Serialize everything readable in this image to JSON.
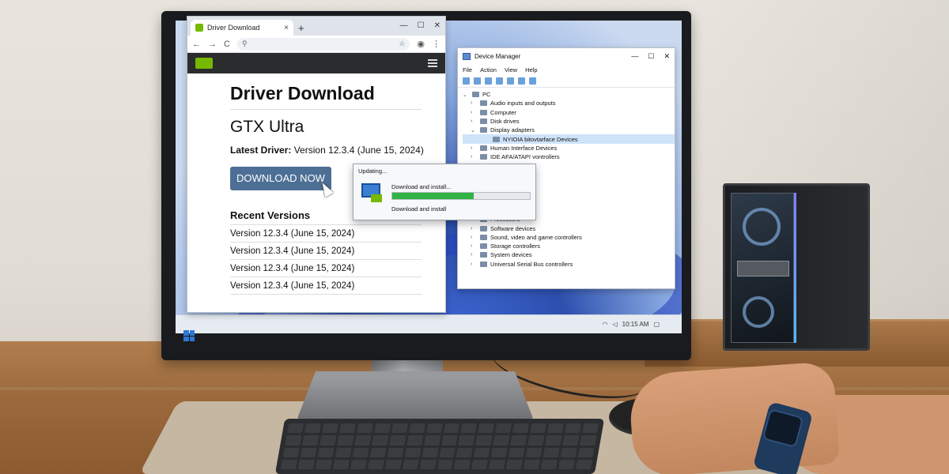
{
  "browser": {
    "tab_title": "Driver Download",
    "tab_close": "×",
    "new_tab": "+",
    "window_controls": [
      "—",
      "☐",
      "✕"
    ],
    "nav": {
      "back": "←",
      "forward": "→",
      "reload": "C"
    },
    "url": "",
    "page": {
      "heading": "Driver Download",
      "product": "GTX Ultra",
      "latest_label": "Latest Driver:",
      "latest_value": "Version 12.3.4 (June 15, 2024)",
      "download_button": "DOWNLOAD NOW",
      "recent_heading": "Recent Versions",
      "versions": [
        "Version 12.3.4 (June 15, 2024)",
        "Version 12.3.4 (June 15, 2024)",
        "Version 12.3.4 (June 15, 2024)",
        "Version 12.3.4 (June 15, 2024)"
      ]
    }
  },
  "device_manager": {
    "title": "Device Manager",
    "window_controls": [
      "—",
      "☐",
      "✕"
    ],
    "menu": [
      "File",
      "Action",
      "View",
      "Help"
    ],
    "root": "PC",
    "items": [
      {
        "label": "Audio inputs and outputs",
        "level": 1,
        "expanded": false
      },
      {
        "label": "Computer",
        "level": 1,
        "expanded": false
      },
      {
        "label": "Disk drives",
        "level": 1,
        "expanded": false
      },
      {
        "label": "Display adapters",
        "level": 1,
        "expanded": true
      },
      {
        "label": "NYIOIA bitovtarface Devices",
        "level": 2,
        "selected": true
      },
      {
        "label": "Human Interface Devices",
        "level": 1,
        "expanded": false
      },
      {
        "label": "IDE AFA/ATAPI vontrollers",
        "level": 1,
        "expanded": false
      },
      {
        "label": "",
        "level": 1,
        "expanded": false
      },
      {
        "label": "ating devices",
        "level": 1,
        "expanded": false
      },
      {
        "label": "",
        "level": 1,
        "expanded": false
      },
      {
        "label": "",
        "level": 1,
        "expanded": false
      },
      {
        "label": "",
        "level": 1,
        "expanded": false
      },
      {
        "label": "",
        "level": 1,
        "expanded": false
      },
      {
        "label": "Processors",
        "level": 1,
        "expanded": false
      },
      {
        "label": "Software devices",
        "level": 1,
        "expanded": false
      },
      {
        "label": "Sound, video and game controllers",
        "level": 1,
        "expanded": false
      },
      {
        "label": "Storage controllers",
        "level": 1,
        "expanded": false
      },
      {
        "label": "System devices",
        "level": 1,
        "expanded": false
      },
      {
        "label": "Universal Serial Bus controllers",
        "level": 1,
        "expanded": false
      }
    ]
  },
  "update_dialog": {
    "title": "Updating...",
    "line1": "Download and install...",
    "progress": 0.59,
    "line2": "Download and install"
  },
  "taskbar": {
    "time": "10:15 AM",
    "icons": [
      "wifi-icon",
      "speaker-icon",
      "notification-icon"
    ]
  },
  "colors": {
    "download_button": "#4d6f95",
    "progress_fill": "#2fb344",
    "brand_green": "#76b900"
  }
}
